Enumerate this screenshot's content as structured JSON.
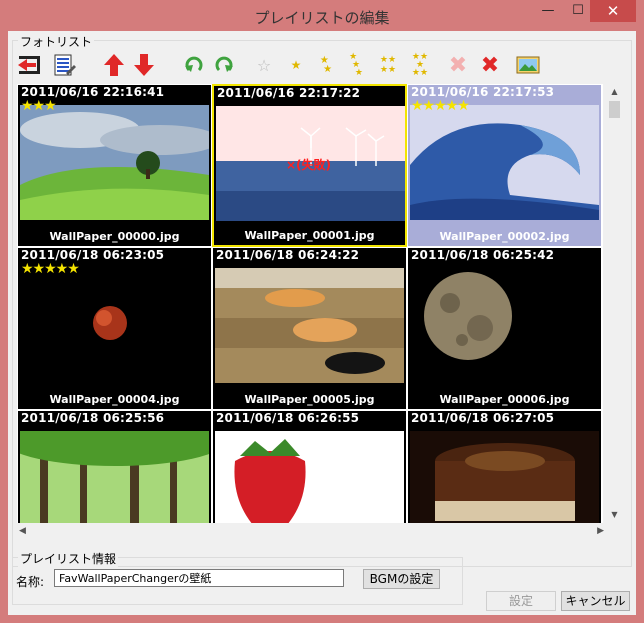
{
  "window": {
    "title": "プレイリストの編集",
    "min_glyph": "—",
    "max_glyph": "☐",
    "close_glyph": "✕"
  },
  "photos_group": {
    "label": "フォトリスト"
  },
  "photos": [
    {
      "timestamp": "2011/06/16 22:16:41",
      "stars": "★★★",
      "filename": "WallPaper_00000.jpg",
      "state": "normal",
      "error": ""
    },
    {
      "timestamp": "2011/06/16 22:17:22",
      "stars": "",
      "filename": "WallPaper_00001.jpg",
      "state": "current",
      "error": "×(失敗)"
    },
    {
      "timestamp": "2011/06/16 22:17:53",
      "stars": "★★★★★",
      "filename": "WallPaper_00002.jpg",
      "state": "selected",
      "error": ""
    },
    {
      "timestamp": "2011/06/18 06:23:05",
      "stars": "★★★★★",
      "filename": "WallPaper_00004.jpg",
      "state": "normal",
      "error": ""
    },
    {
      "timestamp": "2011/06/18 06:24:22",
      "stars": "",
      "filename": "WallPaper_00005.jpg",
      "state": "normal",
      "error": ""
    },
    {
      "timestamp": "2011/06/18 06:25:42",
      "stars": "",
      "filename": "WallPaper_00006.jpg",
      "state": "normal",
      "error": ""
    },
    {
      "timestamp": "2011/06/18 06:25:56",
      "stars": "",
      "filename": "",
      "state": "normal",
      "error": ""
    },
    {
      "timestamp": "2011/06/18 06:26:55",
      "stars": "",
      "filename": "",
      "state": "normal",
      "error": ""
    },
    {
      "timestamp": "2011/06/18 06:27:05",
      "stars": "",
      "filename": "",
      "state": "normal",
      "error": ""
    }
  ],
  "info_group": {
    "label": "プレイリスト情報"
  },
  "name": {
    "label": "名称:",
    "value": "FavWallPaperChangerの壁紙"
  },
  "buttons": {
    "bgm": "BGMの設定",
    "apply": "設定",
    "cancel": "キャンセル"
  },
  "colors": {
    "accent_yellow": "#f2e500",
    "star": "#f4e300",
    "arrow_red": "#e02828",
    "rotate_green": "#3fa33f",
    "selected_bg": "#a9add8"
  }
}
